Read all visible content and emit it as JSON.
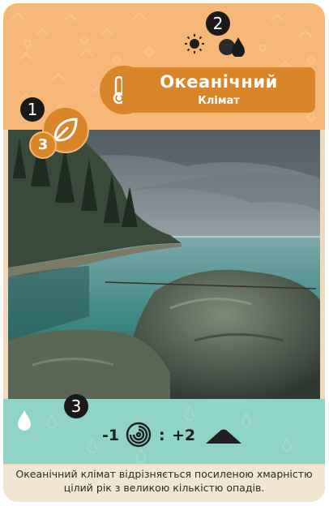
{
  "card": {
    "title": "Океанічний",
    "subtitle": "Клімат",
    "leaf_value": "3",
    "description": "Океанічний клімат відрізняється посиленою хмарністю цілий рік з великою кількістю опадів."
  },
  "markers": {
    "marker_1": "1",
    "marker_2": "2",
    "marker_3": "3"
  },
  "effect": {
    "cloud_modifier": "-1",
    "separator": ":",
    "terrain_modifier": "+2"
  },
  "icons": {
    "weather": [
      "sun-icon",
      "rain-clouds-icon"
    ],
    "climate": "thermometer-droplet-icon",
    "leaf": "leaf-icon",
    "effect": [
      "droplet-icon",
      "spiral-cloud-icon",
      "mountain-icon"
    ]
  },
  "colors": {
    "header": "#f6b879",
    "accent": "#d9852a",
    "effect_band": "#8fd4c7",
    "description_bg": "#f0e6d2",
    "marker": "#1a1a1a"
  }
}
